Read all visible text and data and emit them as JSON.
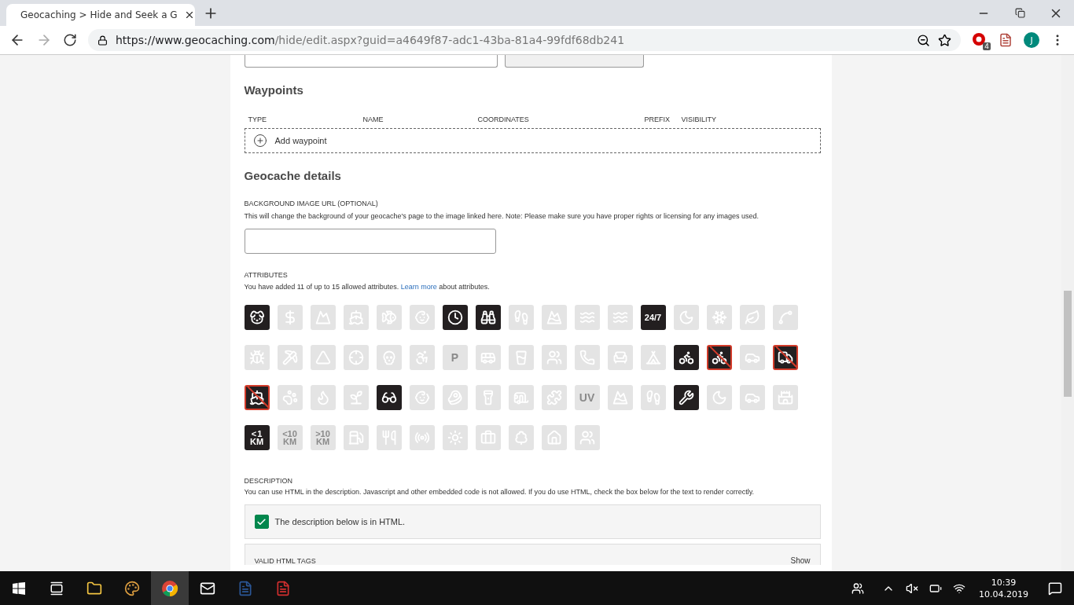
{
  "browser": {
    "tab_title": "Geocaching > Hide and Seek a G",
    "url_host": "https://www.geocaching.com",
    "url_path": "/hide/edit.aspx?guid=a4649f87-adc1-43ba-81a4-99fdf68db241",
    "extension_badge": "4",
    "profile_initial": "J"
  },
  "waypoints": {
    "heading": "Waypoints",
    "columns": [
      "TYPE",
      "NAME",
      "COORDINATES",
      "PREFIX",
      "VISIBILITY"
    ],
    "add_label": "Add waypoint"
  },
  "details": {
    "heading": "Geocache details",
    "background_image": {
      "label": "BACKGROUND IMAGE URL (OPTIONAL)",
      "help": "This will change the background of your geocache's page to the image linked here. Note: Please make sure you have proper rights or licensing for any images used."
    },
    "attributes": {
      "label": "ATTRIBUTES",
      "help_before": "You have added 11 of up to 15 allowed attributes.",
      "link": "Learn more",
      "help_after": "about attributes.",
      "items": [
        {
          "on": true,
          "crossed": false
        },
        {
          "on": false,
          "crossed": false
        },
        {
          "on": false,
          "crossed": false
        },
        {
          "on": false,
          "crossed": false
        },
        {
          "on": false,
          "crossed": false
        },
        {
          "on": false,
          "crossed": false
        },
        {
          "on": true,
          "crossed": false
        },
        {
          "on": true,
          "crossed": false
        },
        {
          "on": false,
          "crossed": false
        },
        {
          "on": false,
          "crossed": false
        },
        {
          "on": false,
          "crossed": false
        },
        {
          "on": false,
          "crossed": false
        },
        {
          "on": true,
          "crossed": false,
          "label": "24/7"
        },
        {
          "on": false,
          "crossed": false
        },
        {
          "on": false,
          "crossed": false
        },
        {
          "on": false,
          "crossed": false
        },
        {
          "on": false,
          "crossed": false
        },
        {
          "on": false,
          "crossed": false
        },
        {
          "on": false,
          "crossed": false
        },
        {
          "on": false,
          "crossed": false
        },
        {
          "on": false,
          "crossed": false
        },
        {
          "on": false,
          "crossed": false
        },
        {
          "on": false,
          "crossed": false
        },
        {
          "on": false,
          "crossed": false,
          "label": "P"
        },
        {
          "on": false,
          "crossed": false
        },
        {
          "on": false,
          "crossed": false
        },
        {
          "on": false,
          "crossed": false
        },
        {
          "on": false,
          "crossed": false
        },
        {
          "on": false,
          "crossed": false
        },
        {
          "on": false,
          "crossed": false
        },
        {
          "on": true,
          "crossed": false
        },
        {
          "on": true,
          "crossed": true
        },
        {
          "on": false,
          "crossed": false
        },
        {
          "on": true,
          "crossed": true
        },
        {
          "on": true,
          "crossed": true
        },
        {
          "on": false,
          "crossed": false
        },
        {
          "on": false,
          "crossed": false
        },
        {
          "on": false,
          "crossed": false
        },
        {
          "on": true,
          "crossed": false
        },
        {
          "on": false,
          "crossed": false
        },
        {
          "on": false,
          "crossed": false
        },
        {
          "on": false,
          "crossed": false
        },
        {
          "on": false,
          "crossed": false
        },
        {
          "on": false,
          "crossed": false
        },
        {
          "on": false,
          "crossed": false,
          "label": "UV"
        },
        {
          "on": false,
          "crossed": false
        },
        {
          "on": false,
          "crossed": false
        },
        {
          "on": true,
          "crossed": false
        },
        {
          "on": false,
          "crossed": false
        },
        {
          "on": false,
          "crossed": false
        },
        {
          "on": false,
          "crossed": false
        },
        {
          "on": true,
          "crossed": false,
          "label": "< 1 KM"
        },
        {
          "on": false,
          "crossed": false,
          "label": "<10 KM"
        },
        {
          "on": false,
          "crossed": false,
          "label": ">10 KM"
        },
        {
          "on": false,
          "crossed": false
        },
        {
          "on": false,
          "crossed": false
        },
        {
          "on": false,
          "crossed": false
        },
        {
          "on": false,
          "crossed": false
        },
        {
          "on": false,
          "crossed": false
        },
        {
          "on": false,
          "crossed": false
        },
        {
          "on": false,
          "crossed": false
        },
        {
          "on": false,
          "crossed": false
        }
      ]
    },
    "description": {
      "label": "DESCRIPTION",
      "help": "You can use HTML in the description. Javascript and other embedded code is not allowed. If you do use HTML, check the box below for the text to render correctly.",
      "html_checkbox": {
        "label": "The description below is in HTML.",
        "checked": true
      },
      "valid_tags": {
        "label": "VALID HTML TAGS",
        "toggle": "Show"
      }
    }
  },
  "taskbar": {
    "time": "10:39",
    "date": "10.04.2019"
  }
}
